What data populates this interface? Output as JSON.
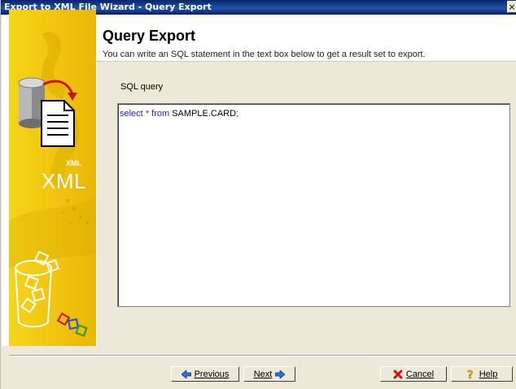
{
  "window": {
    "title": "Export to XML File Wizard - Query Export",
    "close_glyph": "×"
  },
  "header": {
    "title": "Query Export",
    "description": "You can write an SQL statement in the text box below to get a result set to export."
  },
  "banner": {
    "xml_small": "XML",
    "xml_big": "XML"
  },
  "query": {
    "label": "SQL query",
    "tokens": {
      "select": "select",
      "star": "*",
      "from": "from",
      "table": "SAMPLE.CARD",
      "semicolon": ";"
    }
  },
  "buttons": {
    "previous": "Previous",
    "next": "Next",
    "cancel": "Cancel",
    "help": "Help"
  },
  "colors": {
    "keyword": "#1a1aff",
    "operator": "#d40000",
    "banner": "#f1c40f",
    "title_bar": "#0a246a"
  },
  "icons": [
    "left-arrow-icon",
    "right-arrow-icon",
    "cancel-x-icon",
    "help-question-icon",
    "database-icon",
    "document-icon"
  ]
}
